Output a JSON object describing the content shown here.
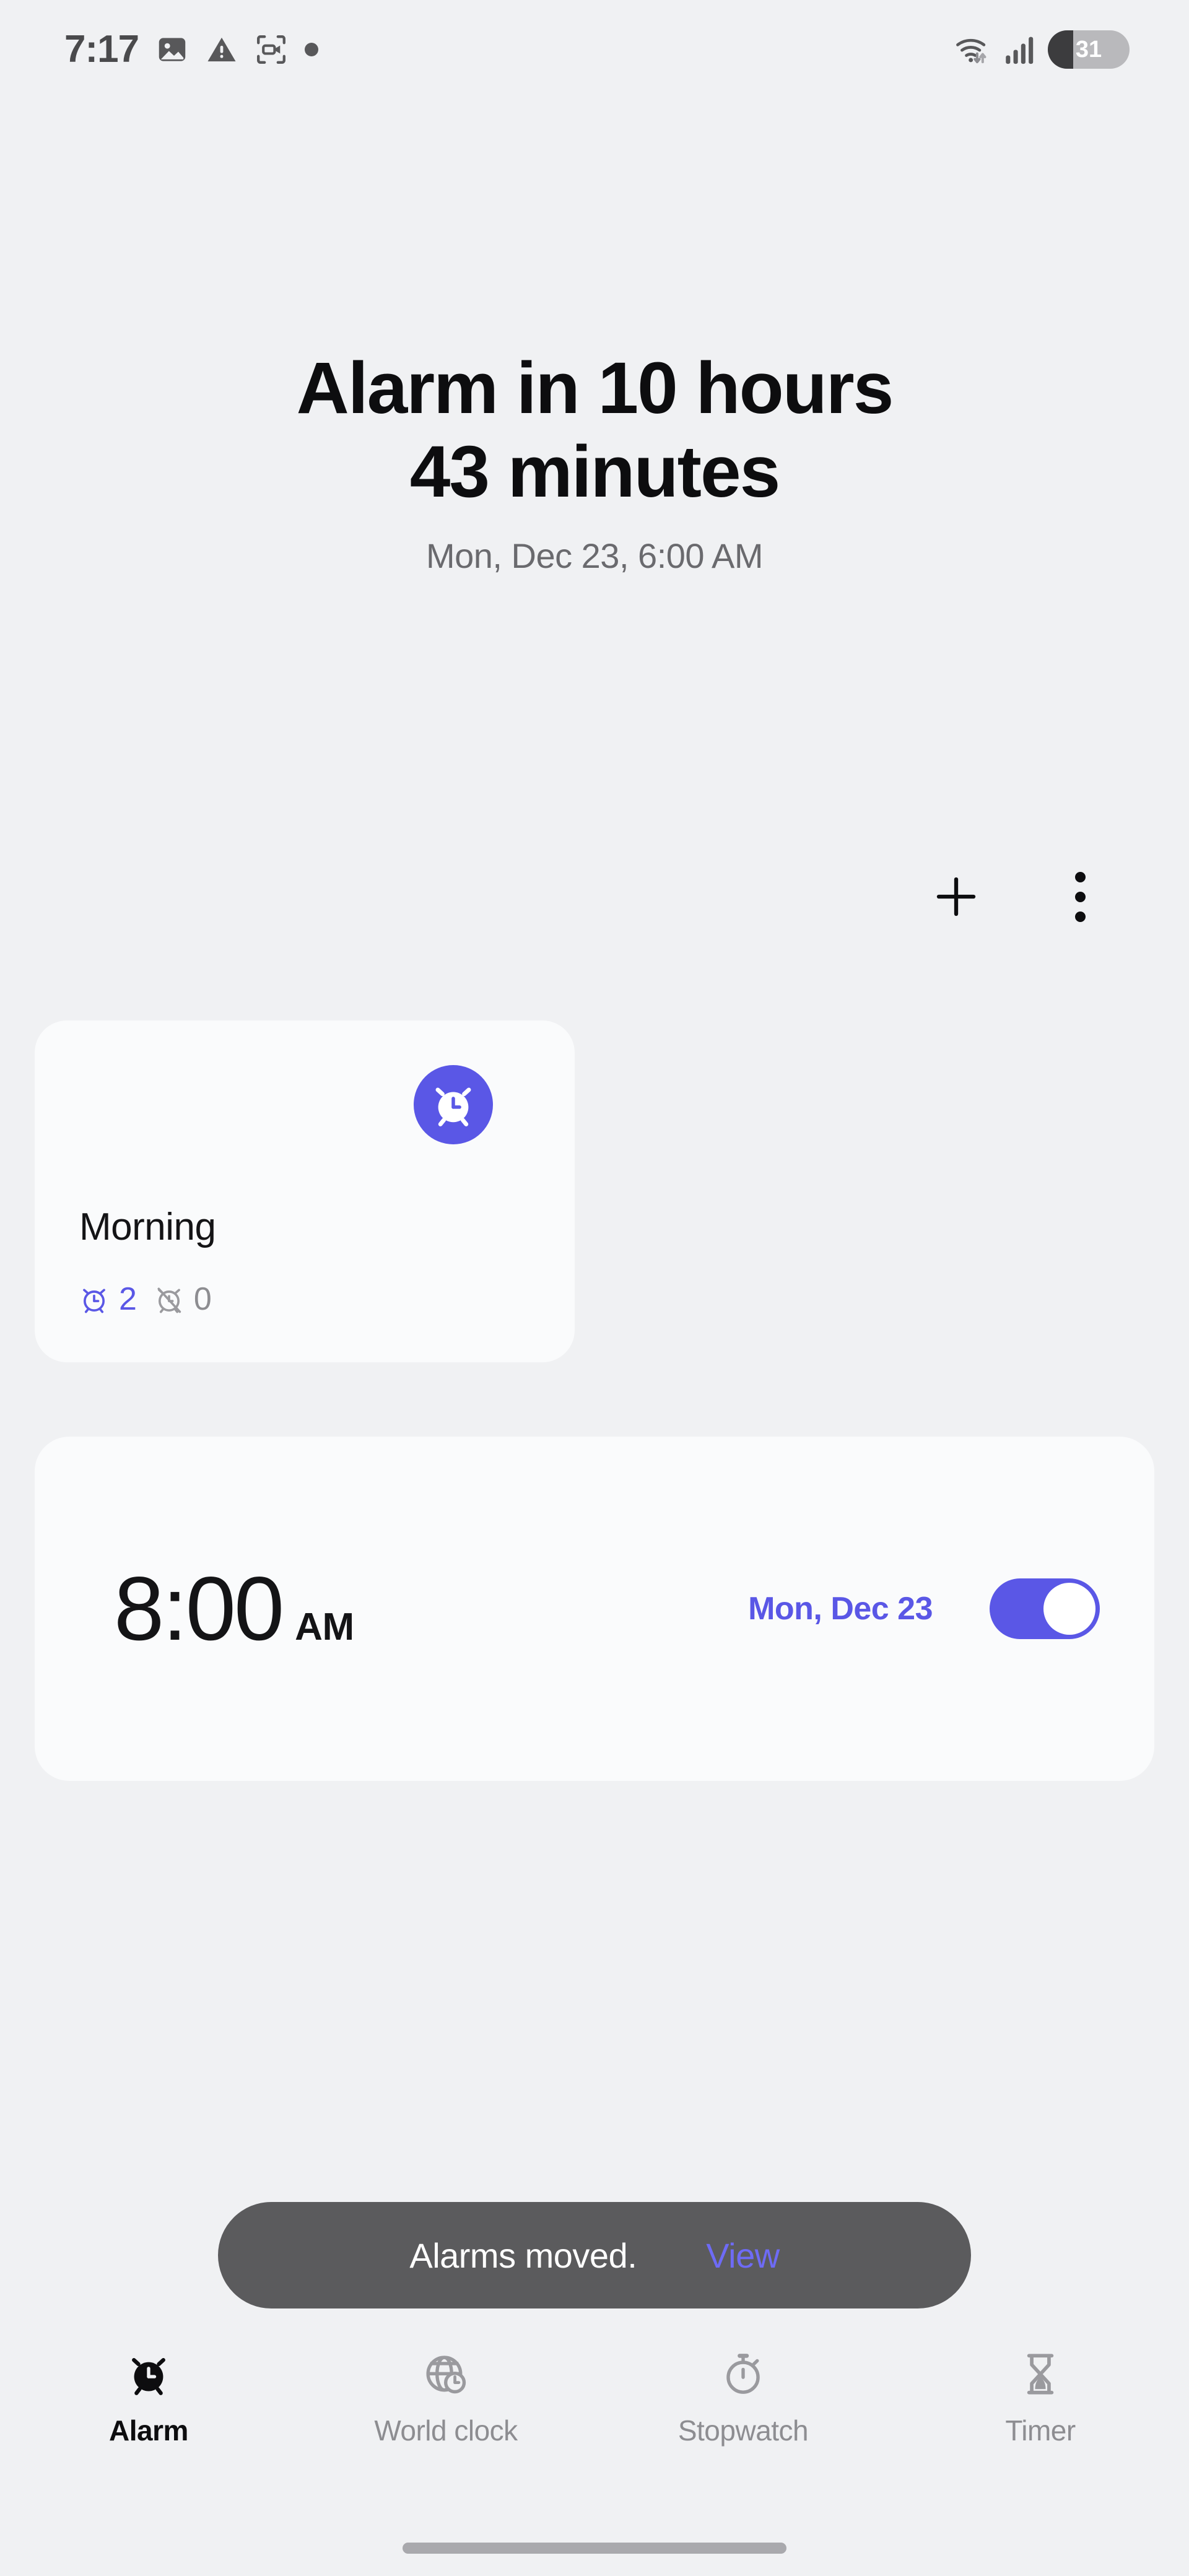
{
  "status_bar": {
    "time": "7:17",
    "left_icons": [
      "image-icon",
      "warning-triangle-icon",
      "screen-record-icon",
      "dot-indicator-icon"
    ],
    "right_icons": [
      "wifi-icon",
      "cellular-signal-icon"
    ],
    "battery_level": "31",
    "battery_percent": 31
  },
  "header": {
    "headline_line1": "Alarm in 10 hours",
    "headline_line2": "43 minutes",
    "subhead": "Mon, Dec 23, 6:00 AM"
  },
  "actions": {
    "add_label": "add-alarm",
    "more_label": "more-options"
  },
  "alarm_group": {
    "title": "Morning",
    "badge_icon": "alarm-clock-icon",
    "enabled_count": "2",
    "disabled_count": "0"
  },
  "alarms": [
    {
      "time": "8:00",
      "meridiem": "AM",
      "date": "Mon, Dec 23",
      "enabled": true
    }
  ],
  "snackbar": {
    "message": "Alarms moved.",
    "action": "View"
  },
  "bottom_nav": {
    "tabs": [
      {
        "label": "Alarm",
        "icon": "alarm-clock-icon",
        "active": true
      },
      {
        "label": "World clock",
        "icon": "globe-clock-icon",
        "active": false
      },
      {
        "label": "Stopwatch",
        "icon": "stopwatch-icon",
        "active": false
      },
      {
        "label": "Timer",
        "icon": "hourglass-icon",
        "active": false
      }
    ]
  },
  "colors": {
    "accent": "#5a57e6",
    "background": "#f0f1f3",
    "card": "#fafbfc",
    "snackbar_bg": "#5b5b5d",
    "snackbar_action": "#6e6bf5",
    "text_primary": "#141416",
    "text_muted": "#8d8d91"
  }
}
